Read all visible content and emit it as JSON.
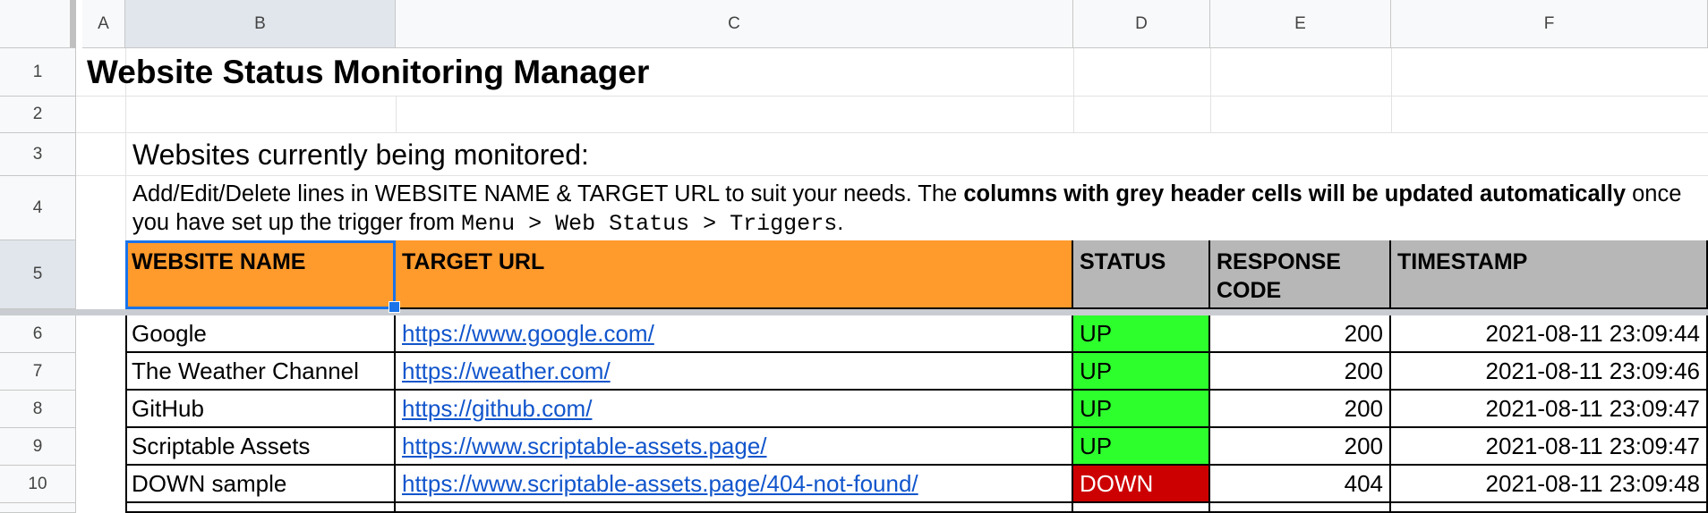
{
  "columns": [
    "A",
    "B",
    "C",
    "D",
    "E",
    "F"
  ],
  "rows": [
    "1",
    "2",
    "3",
    "4",
    "5",
    "6",
    "7",
    "8",
    "9",
    "10"
  ],
  "sheet": {
    "title": "Website Status Monitoring Manager",
    "subtitle": "Websites currently being monitored:",
    "desc_part1": "Add/Edit/Delete lines in WEBSITE NAME & TARGET URL to suit your needs. The ",
    "desc_bold": "columns with grey header cells will be updated automatically",
    "desc_part2": " once you have set up the trigger from ",
    "desc_code": "Menu > Web Status > Triggers",
    "desc_end": "."
  },
  "table": {
    "headers": [
      "WEBSITE NAME",
      "TARGET URL",
      "STATUS",
      "RESPONSE CODE",
      "TIMESTAMP"
    ],
    "rows": [
      {
        "name": "Google",
        "url": "https://www.google.com/",
        "status": "UP",
        "code": "200",
        "timestamp": "2021-08-11 23:09:44"
      },
      {
        "name": "The Weather Channel",
        "url": "https://weather.com/",
        "status": "UP",
        "code": "200",
        "timestamp": "2021-08-11 23:09:46"
      },
      {
        "name": "GitHub",
        "url": "https://github.com/",
        "status": "UP",
        "code": "200",
        "timestamp": "2021-08-11 23:09:47"
      },
      {
        "name": "Scriptable Assets",
        "url": "https://www.scriptable-assets.page/",
        "status": "UP",
        "code": "200",
        "timestamp": "2021-08-11 23:09:47"
      },
      {
        "name": "DOWN sample",
        "url": "https://www.scriptable-assets.page/404-not-found/",
        "status": "DOWN",
        "code": "404",
        "timestamp": "2021-08-11 23:09:48"
      }
    ]
  },
  "colors": {
    "editable_header": "#ff9a2c",
    "auto_header": "#b7b7b7",
    "status_up": "#2dff2d",
    "status_down": "#cc0000",
    "link": "#1155cc",
    "selection": "#1a73e8"
  }
}
